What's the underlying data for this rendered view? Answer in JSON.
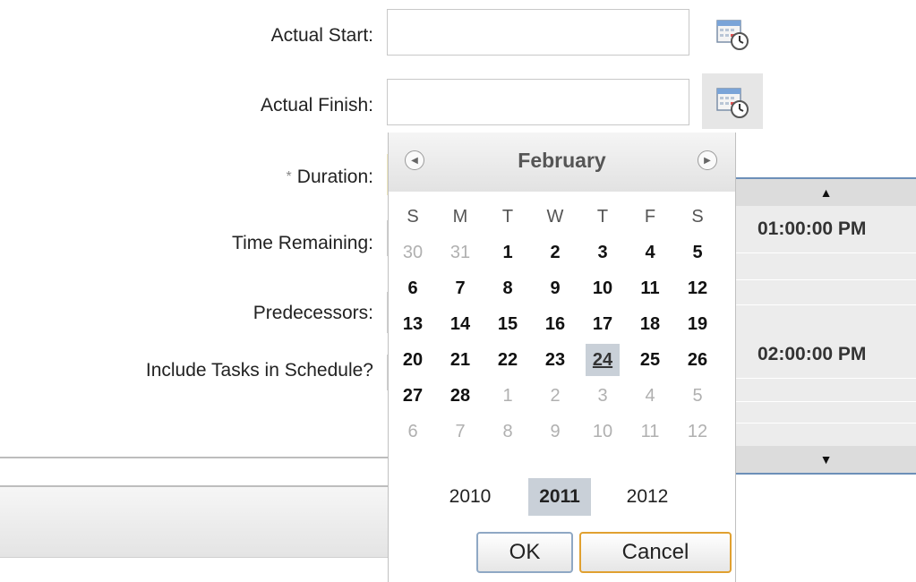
{
  "form": {
    "actual_start_label": "Actual Start:",
    "actual_finish_label": "Actual Finish:",
    "duration_label": "Duration:",
    "required_marker": "*",
    "time_remaining_label": "Time Remaining:",
    "predecessors_label": "Predecessors:",
    "include_tasks_label": "Include Tasks in Schedule?",
    "actual_start_value": "",
    "actual_finish_value": ""
  },
  "calendar": {
    "month": "February",
    "weekdays": [
      "S",
      "M",
      "T",
      "W",
      "T",
      "F",
      "S"
    ],
    "rows": [
      [
        "30",
        "31",
        "1",
        "2",
        "3",
        "4",
        "5"
      ],
      [
        "6",
        "7",
        "8",
        "9",
        "10",
        "11",
        "12"
      ],
      [
        "13",
        "14",
        "15",
        "16",
        "17",
        "18",
        "19"
      ],
      [
        "20",
        "21",
        "22",
        "23",
        "24",
        "25",
        "26"
      ],
      [
        "27",
        "28",
        "1",
        "2",
        "3",
        "4",
        "5"
      ],
      [
        "6",
        "7",
        "8",
        "9",
        "10",
        "11",
        "12"
      ]
    ],
    "selected_day": "24",
    "years": [
      "2010",
      "2011",
      "2012"
    ],
    "selected_year": "2011",
    "ok_label": "OK",
    "cancel_label": "Cancel"
  },
  "time_picker": {
    "slots": [
      "01:00:00 PM",
      "02:00:00 PM"
    ]
  },
  "icons": {
    "calendar": "calendar-clock-icon",
    "prev": "chevron-left-circle-icon",
    "next": "chevron-right-circle-icon",
    "up": "triangle-up-icon",
    "down": "triangle-down-icon"
  },
  "colors": {
    "selection": "#c9d0d8",
    "cancel_focus": "#e0a030",
    "time_border": "#6c8fb8"
  }
}
